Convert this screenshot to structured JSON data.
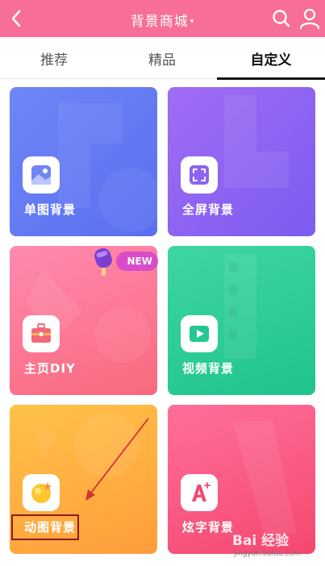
{
  "header": {
    "title": "背景商城",
    "caret": "▾"
  },
  "tabs": [
    {
      "label": "推荐",
      "active": false
    },
    {
      "label": "精品",
      "active": false
    },
    {
      "label": "自定义",
      "active": true
    }
  ],
  "cards": [
    {
      "label": "单图背景",
      "icon": "image-icon"
    },
    {
      "label": "全屏背景",
      "icon": "fullscreen-icon"
    },
    {
      "label": "主页DIY",
      "icon": "toolbox-icon",
      "badge": "NEW"
    },
    {
      "label": "视频背景",
      "icon": "video-play-icon"
    },
    {
      "label": "动图背景",
      "icon": "gif-sticker-icon"
    },
    {
      "label": "炫字背景",
      "icon": "font-a-icon"
    }
  ],
  "watermark": {
    "brand": "Bai 经验",
    "url": "jingyan.baidu.com"
  },
  "colors": {
    "header": "#f76f96",
    "card_single": "#5a6ff0",
    "card_fullscreen": "#7c5cf0",
    "card_diy": "#f9697d",
    "card_video": "#1fc38d",
    "card_gif": "#ff9d3b",
    "card_font": "#f4486f",
    "highlight_box": "#8b1a1a"
  }
}
